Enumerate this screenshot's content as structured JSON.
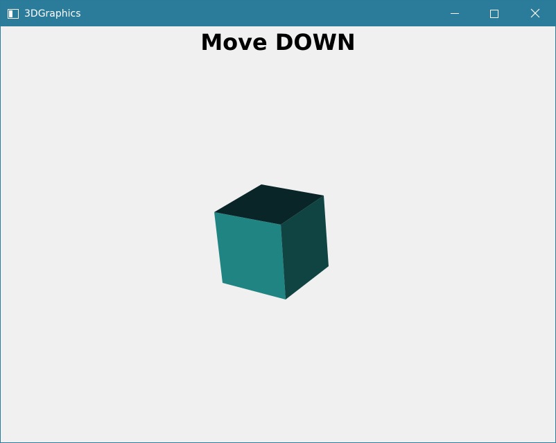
{
  "window": {
    "title": "3DGraphics",
    "titlebar_color": "#2b7b9a",
    "icons": {
      "app": "app-window-icon",
      "minimize": "minimize-icon",
      "maximize": "maximize-icon",
      "close": "close-icon"
    }
  },
  "canvas": {
    "heading": "Move DOWN",
    "background": "#f0f0f0",
    "cube": {
      "front_color": "#208482",
      "right_color": "#104443",
      "top_color": "#0a2527"
    }
  }
}
